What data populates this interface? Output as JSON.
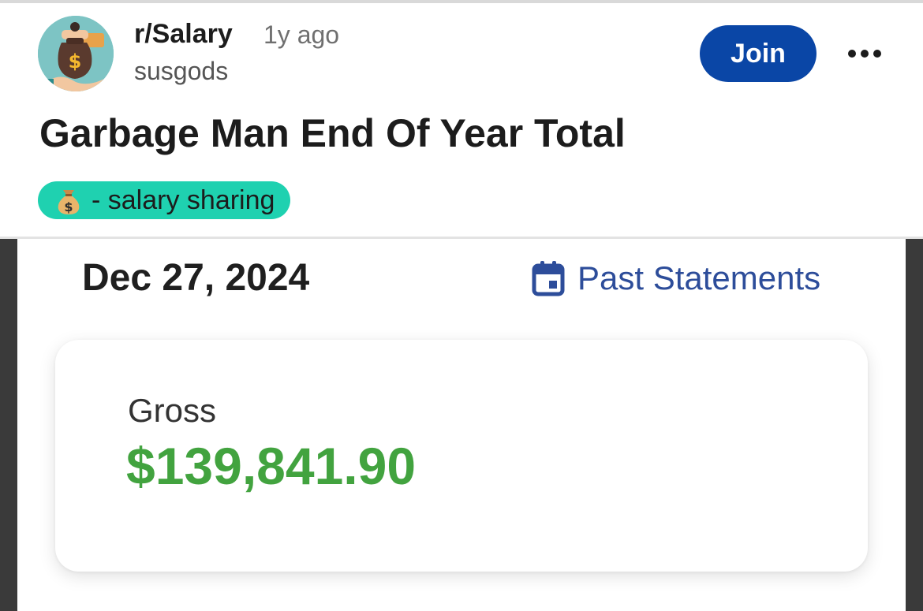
{
  "post": {
    "subreddit": "r/Salary",
    "time_ago": "1y ago",
    "author": "susgods",
    "join_label": "Join",
    "title": "Garbage Man End Of Year Total",
    "flair": "- salary sharing"
  },
  "statement": {
    "date": "Dec 27, 2024",
    "past_statements_label": "Past Statements",
    "gross_label": "Gross",
    "gross_amount": "$139,841.90"
  },
  "colors": {
    "join_button": "#0a46a6",
    "flair_background": "#1fd1b0",
    "gross_amount": "#42a33f",
    "link_blue": "#2d4d9a"
  },
  "icons": {
    "avatar": "money-bag-hand-icon",
    "more": "more-dots-icon",
    "flair": "money-bag-icon",
    "past_statements": "calendar-icon"
  }
}
